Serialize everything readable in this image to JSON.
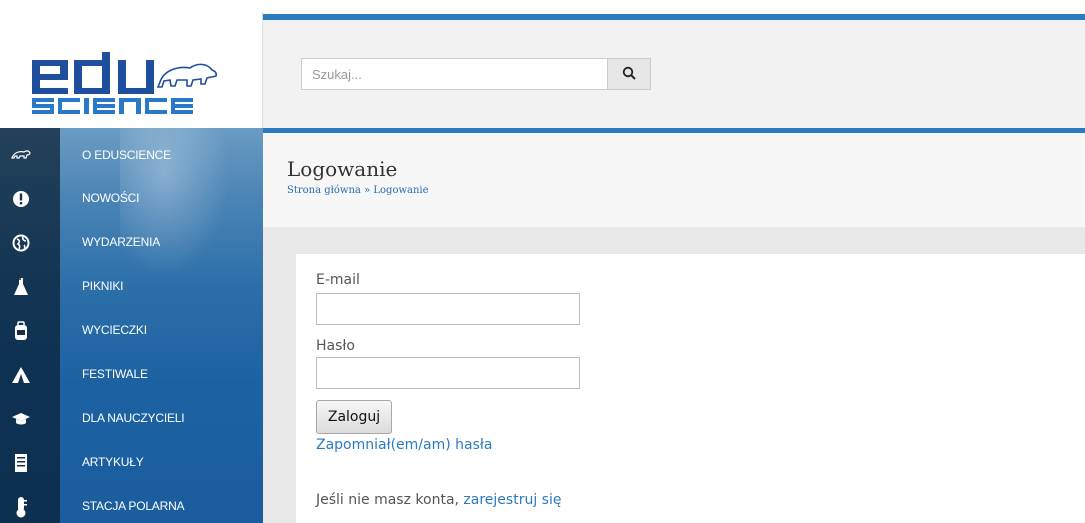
{
  "header": {
    "search_placeholder": "Szukaj...",
    "search_button_icon": "search-icon"
  },
  "sidebar": {
    "items": [
      {
        "label": "O EDUSCIENCE",
        "icon": "polar-bear-icon"
      },
      {
        "label": "NOWOŚCI",
        "icon": "exclamation-icon"
      },
      {
        "label": "WYDARZENIA",
        "icon": "globe-icon"
      },
      {
        "label": "PIKNIKI",
        "icon": "flask-icon"
      },
      {
        "label": "WYCIECZKI",
        "icon": "backpack-icon"
      },
      {
        "label": "FESTIWALE",
        "icon": "tent-icon"
      },
      {
        "label": "DLA NAUCZYCIELI",
        "icon": "graduation-cap-icon"
      },
      {
        "label": "ARTYKUŁY",
        "icon": "document-icon"
      },
      {
        "label": "STACJA POLARNA",
        "icon": "thermometer-icon"
      }
    ]
  },
  "page": {
    "title": "Logowanie",
    "breadcrumb_home": "Strona główna",
    "breadcrumb_sep": " » ",
    "breadcrumb_current": "Logowanie"
  },
  "form": {
    "email_label": "E-mail",
    "email_value": "",
    "password_label": "Hasło",
    "password_value": "",
    "login_button": "Zaloguj",
    "forgot_link": "Zapomniał(em/am) hasła",
    "register_prefix": "Jeśli nie masz konta, ",
    "register_link": "zarejestruj się"
  },
  "colors": {
    "accent": "#2b7bc0",
    "logo_blue": "#1f4e9c",
    "sidebar_blue": "#1c62a2"
  }
}
